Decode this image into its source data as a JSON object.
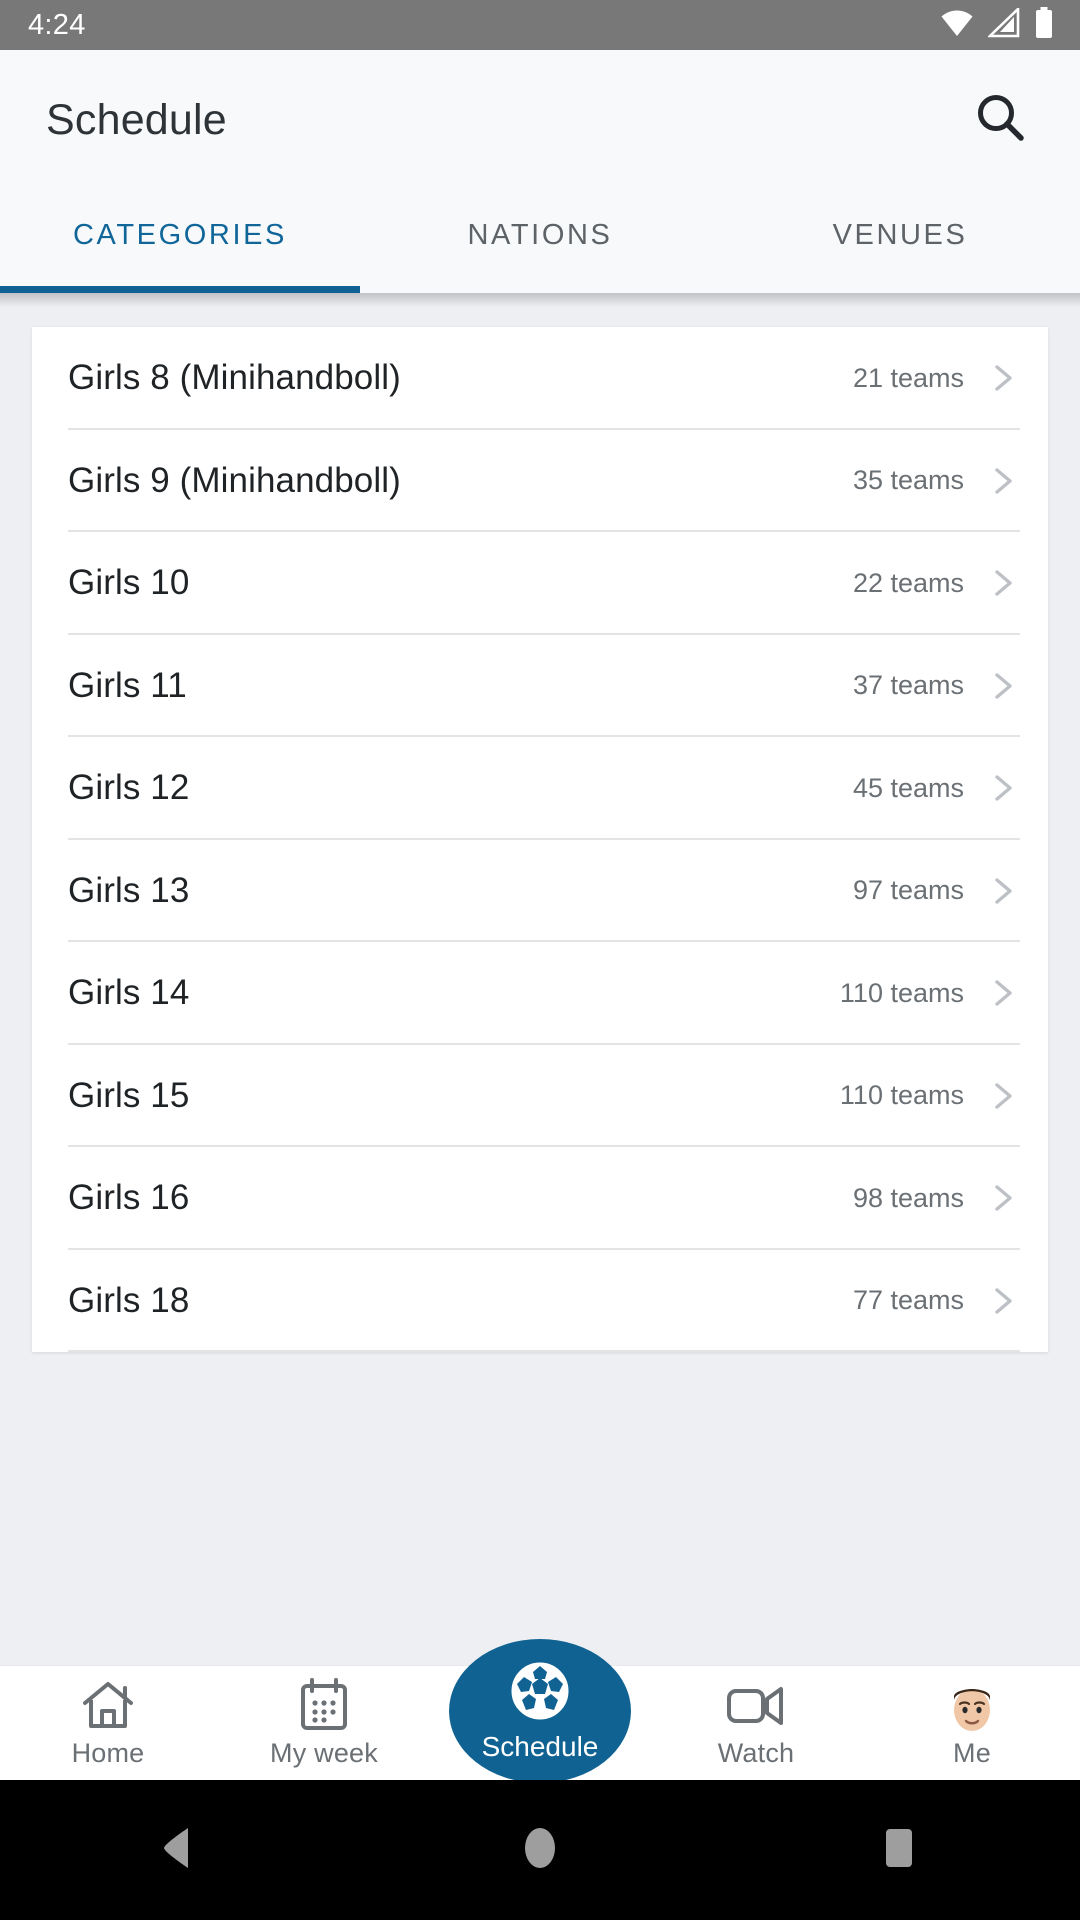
{
  "status_bar": {
    "time": "4:24",
    "icons": [
      "wifi-icon",
      "cellular-signal-icon",
      "battery-icon"
    ],
    "background": "#787878"
  },
  "app_bar": {
    "title": "Schedule",
    "search_icon": "search-icon",
    "background": "#F7F9FB"
  },
  "tabs": {
    "active_index": 0,
    "accent_color": "#0F6394",
    "inactive_color": "#5E6368",
    "items": [
      {
        "label": "CATEGORIES"
      },
      {
        "label": "NATIONS"
      },
      {
        "label": "VENUES"
      }
    ]
  },
  "list": {
    "chevron_icon": "chevron-right-icon",
    "rows": [
      {
        "label": "Girls 8 (Minihandboll)",
        "count": "21 teams"
      },
      {
        "label": "Girls 9 (Minihandboll)",
        "count": "35 teams"
      },
      {
        "label": "Girls 10",
        "count": "22 teams"
      },
      {
        "label": "Girls 11",
        "count": "37 teams"
      },
      {
        "label": "Girls 12",
        "count": "45 teams"
      },
      {
        "label": "Girls 13",
        "count": "97 teams"
      },
      {
        "label": "Girls 14",
        "count": "110 teams"
      },
      {
        "label": "Girls 15",
        "count": "110 teams"
      },
      {
        "label": "Girls 16",
        "count": "98 teams"
      },
      {
        "label": "Girls 18",
        "count": "77 teams"
      }
    ]
  },
  "bottom_nav": {
    "active": "Schedule",
    "active_color": "#106292",
    "items": [
      {
        "label": "Home",
        "icon": "home-icon"
      },
      {
        "label": "My week",
        "icon": "calendar-icon"
      },
      {
        "label": "Schedule",
        "icon": "soccer-ball-icon"
      },
      {
        "label": "Watch",
        "icon": "video-camera-icon"
      },
      {
        "label": "Me",
        "icon": "avatar-icon"
      }
    ]
  },
  "android_nav": {
    "back": "back-triangle-icon",
    "home": "home-circle-icon",
    "recents": "recents-square-icon"
  }
}
